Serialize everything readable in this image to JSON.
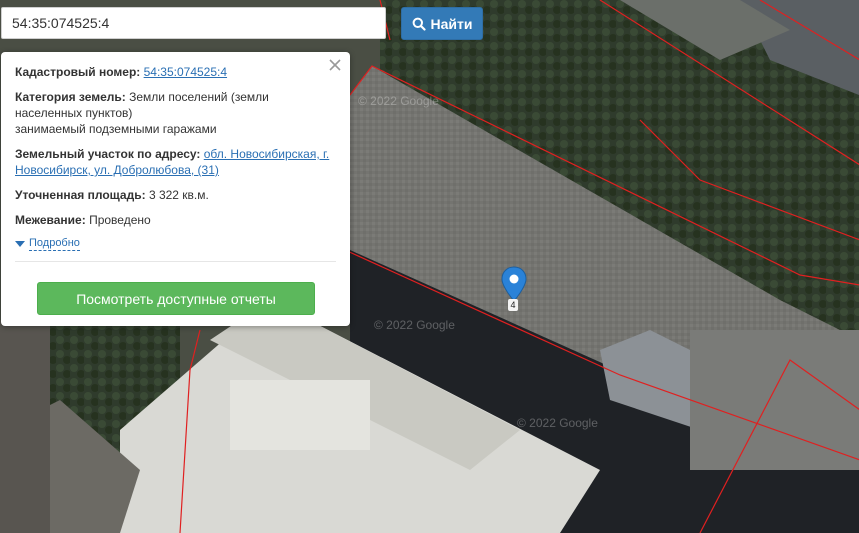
{
  "search": {
    "value": "54:35:074525:4",
    "button_label": "Найти"
  },
  "popup": {
    "cadastral_label": "Кадастровый номер:",
    "cadastral_value": "54:35:074525:4",
    "category_label": "Категория земель:",
    "category_value_line1": "Земли поселений (земли",
    "category_value_line2": "населенных пунктов)",
    "category_value_line3": "занимаемый подземными гаражами",
    "address_label": "Земельный участок по адресу:",
    "address_value_line1": "обл. Новосибирская, г.",
    "address_value_line2": "Новосибирск, ул. Добролюбова, (31)",
    "area_label": "Уточненная площадь:",
    "area_value": "3 322 кв.м.",
    "survey_label": "Межевание:",
    "survey_value": "Проведено",
    "details_label": "Подробно",
    "report_button_label": "Посмотреть доступные отчеты"
  },
  "map": {
    "marker_label": "4",
    "watermarks": [
      "© 2022 Google",
      "© 2022 Google",
      "© 2022 Google"
    ],
    "parcel_border_color": "#e02020",
    "marker_color": "#2a82d8"
  }
}
